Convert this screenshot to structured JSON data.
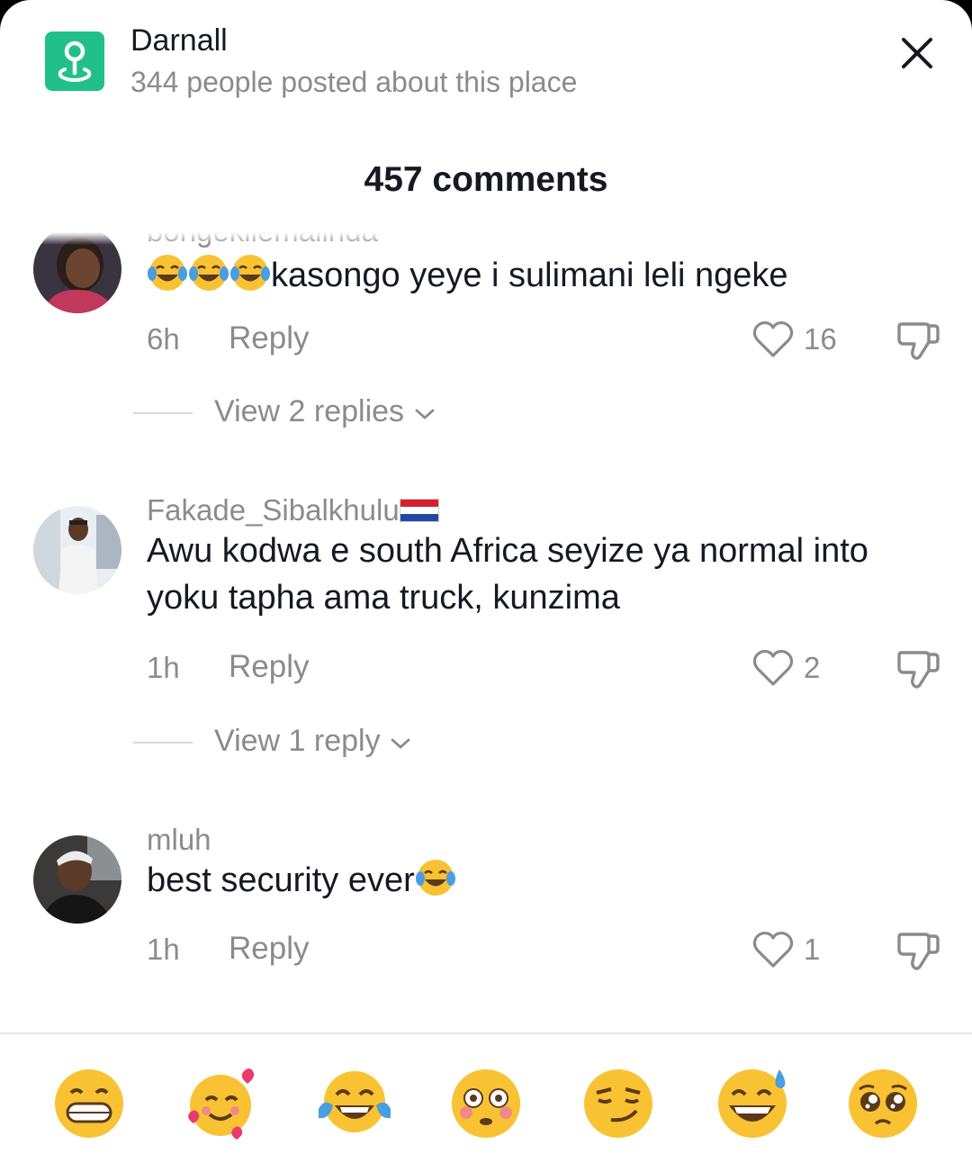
{
  "place": {
    "name": "Darnall",
    "subtitle": "344 people posted about this place",
    "icon": "location-pin-icon"
  },
  "comments_header": {
    "title": "457 comments"
  },
  "comments": [
    {
      "username": "bongekilemalinda",
      "text": "kasongo yeye i sulimani leli ngeke",
      "emoji_prefix": [
        "face-with-tears-of-joy",
        "face-with-tears-of-joy",
        "face-with-tears-of-joy"
      ],
      "time": "6h",
      "reply_label": "Reply",
      "likes": "16",
      "view_replies": "View 2 replies"
    },
    {
      "username": "Fakade_Sibalkhulu",
      "username_flag": "netherlands-flag",
      "text": "Awu kodwa e south Africa seyize ya normal into yoku tapha ama truck, kunzima",
      "time": "1h",
      "reply_label": "Reply",
      "likes": "2",
      "view_replies": "View 1 reply"
    },
    {
      "username": "mluh",
      "text": "best security ever",
      "emoji_suffix": "face-with-tears-of-joy",
      "time": "1h",
      "reply_label": "Reply",
      "likes": "1"
    }
  ],
  "emoji_bar": [
    "grinning-face",
    "smiling-face-with-hearts",
    "face-with-tears-of-joy",
    "flushed-face",
    "smirking-face",
    "grinning-face-with-sweat",
    "pleading-face"
  ],
  "colors": {
    "accent": "#21c08b",
    "muted": "#8a8b91",
    "text": "#161823"
  }
}
